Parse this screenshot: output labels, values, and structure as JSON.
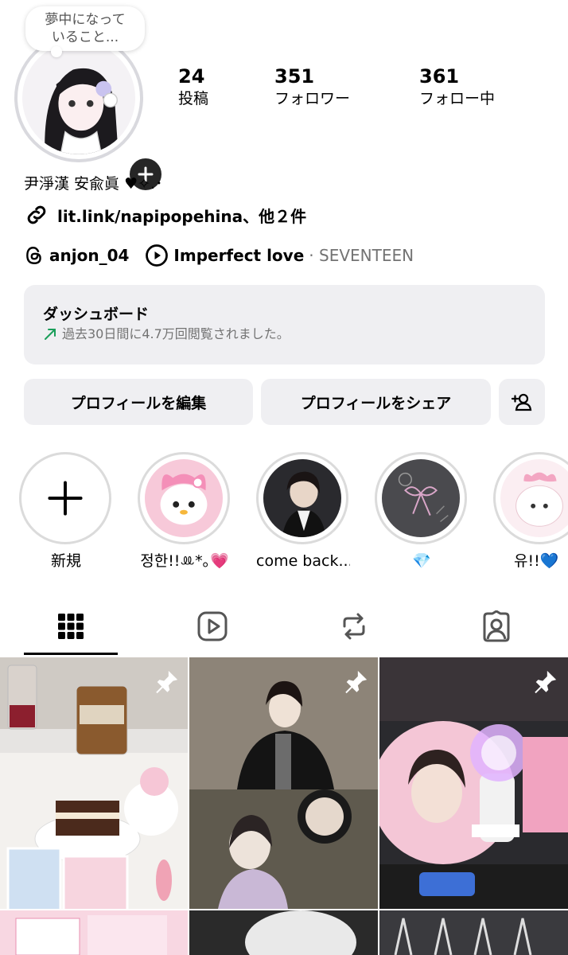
{
  "profile": {
    "note": "夢中になって\nいること...",
    "stats": [
      {
        "value": "24",
        "label": "投稿"
      },
      {
        "value": "351",
        "label": "フォロワー"
      },
      {
        "value": "361",
        "label": "フォロー中"
      }
    ],
    "bio_name": "尹淨漢 安兪眞 ♥︎✧.･",
    "link_text": "lit.link/napipopehina、他２件",
    "threads_handle": "anjon_04",
    "music_title": "Imperfect love",
    "music_artist": "· SEVENTEEN"
  },
  "dashboard": {
    "title": "ダッシュボード",
    "subtitle": "過去30日間に4.7万回閲覧されました。"
  },
  "buttons": {
    "edit": "プロフィールを編集",
    "share": "プロフィールをシェア"
  },
  "highlights": [
    {
      "label": "新規"
    },
    {
      "label": "정한!!ꔛ*｡💗"
    },
    {
      "label": "come back..."
    },
    {
      "label": "💎"
    },
    {
      "label": "유!!💙"
    }
  ],
  "icons": {
    "add": "plus-icon",
    "link": "link-icon",
    "threads": "threads-icon",
    "play": "play-circle-icon",
    "trend": "trend-up-arrow-icon",
    "add_person": "add-person-icon",
    "grid": "grid-icon",
    "reels": "reels-icon",
    "reposts": "repost-icon",
    "tagged": "tagged-icon",
    "pin": "pin-icon"
  },
  "colors": {
    "button_bg": "#efeff2",
    "muted_text": "#737373",
    "trend_green": "#1a9e5a"
  }
}
